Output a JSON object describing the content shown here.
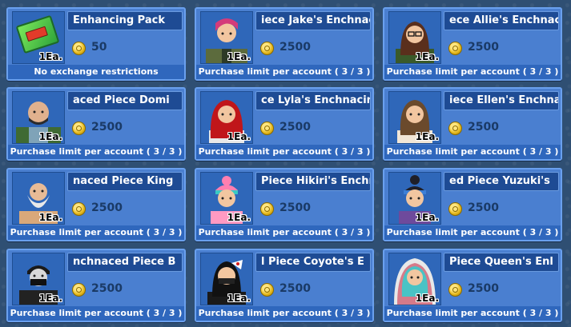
{
  "items": [
    {
      "title": "Enhancing Pack",
      "qty": "1Ea.",
      "price": "50",
      "limit": "No exchange restrictions",
      "icon": "enhancing-pack-icon",
      "hair": "",
      "skin": ""
    },
    {
      "title": "iece     Jake's Enchnacing",
      "qty": "1Ea.",
      "price": "2500",
      "limit": "Purchase limit per account ( 3 / 3 )",
      "icon": "jake-avatar",
      "hair": "#d43b7a",
      "skin": "#f2c6a0"
    },
    {
      "title": "ece     Allie's Enchnacing",
      "qty": "1Ea.",
      "price": "2500",
      "limit": "Purchase limit per account ( 3 / 3 )",
      "icon": "allie-avatar",
      "hair": "#5a2f1c",
      "skin": "#f2c6a0"
    },
    {
      "title": "aced Piece          Domi",
      "qty": "1Ea.",
      "price": "2500",
      "limit": "Purchase limit per account ( 3 / 3 )",
      "icon": "domi-avatar",
      "hair": "#2b2b2b",
      "skin": "#e0b18e"
    },
    {
      "title": "ce     Lyla's Enchnacing",
      "qty": "1Ea.",
      "price": "2500",
      "limit": "Purchase limit per account ( 3 / 3 )",
      "icon": "lyla-avatar",
      "hair": "#c0161a",
      "skin": "#f2c6a0"
    },
    {
      "title": "iece     Ellen's Enchnac",
      "qty": "1Ea.",
      "price": "2500",
      "limit": "Purchase limit per account ( 3 / 3 )",
      "icon": "ellen-avatar",
      "hair": "#6b4a2c",
      "skin": "#f2c6a0"
    },
    {
      "title": "naced Piece          King",
      "qty": "1Ea.",
      "price": "2500",
      "limit": "Purchase limit per account ( 3 / 3 )",
      "icon": "king-avatar",
      "hair": "#e9e9e9",
      "skin": "#e8bb96"
    },
    {
      "title": "Piece     Hikiri's Enchnac",
      "qty": "1Ea.",
      "price": "2500",
      "limit": "Purchase limit per account ( 3 / 3 )",
      "icon": "hikiri-avatar",
      "hair": "#ff7fb0",
      "skin": "#f2c6a0"
    },
    {
      "title": "ed Piece     Yuzuki's",
      "qty": "1Ea.",
      "price": "2500",
      "limit": "Purchase limit per account ( 3 / 3 )",
      "icon": "yuzuki-avatar",
      "hair": "#1f1f28",
      "skin": "#f2c6a0"
    },
    {
      "title": "nchnaced Piece     B",
      "qty": "1Ea.",
      "price": "2500",
      "limit": "Purchase limit per account ( 3 / 3 )",
      "icon": "b-avatar",
      "hair": "#1a1a1a",
      "skin": "#d9d9d9"
    },
    {
      "title": "l Piece     Coyote's E",
      "qty": "1Ea.",
      "price": "2500",
      "limit": "Purchase limit per account ( 3 / 3 )",
      "icon": "coyote-avatar",
      "hair": "#111111",
      "skin": "#f2c6a0"
    },
    {
      "title": "Piece     Queen's Enl",
      "qty": "1Ea.",
      "price": "2500",
      "limit": "Purchase limit per account ( 3 / 3 )",
      "icon": "queen-avatar",
      "hair": "#49c3c5",
      "skin": "#f2c6a0"
    }
  ]
}
